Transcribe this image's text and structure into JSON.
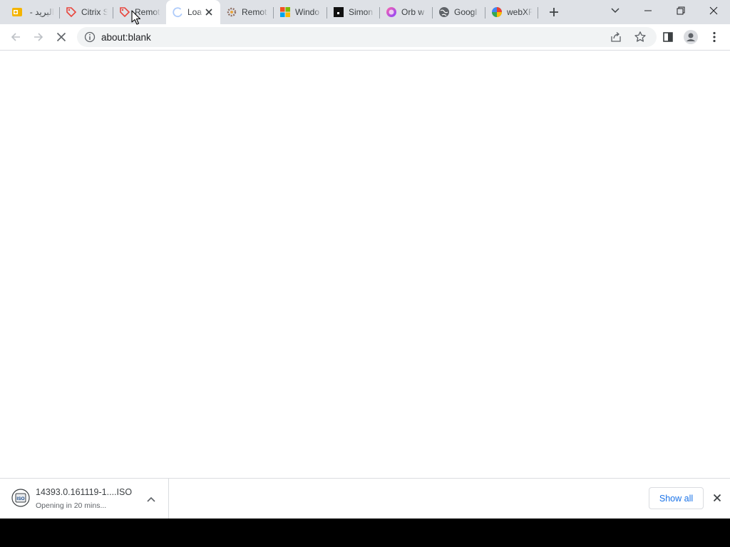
{
  "tabs": [
    {
      "title": "البريد -",
      "icon": "outlook-mail-icon"
    },
    {
      "title": "Citrix S",
      "icon": "tag-icon"
    },
    {
      "title": "Remot",
      "icon": "tag-icon"
    },
    {
      "title": "Loa",
      "icon": "loading-spinner-icon",
      "active": true
    },
    {
      "title": "Remot",
      "icon": "gear-icon"
    },
    {
      "title": "Windo",
      "icon": "windows-logo-icon"
    },
    {
      "title": "Simon",
      "icon": "black-square-icon"
    },
    {
      "title": "Orb w",
      "icon": "orb-icon"
    },
    {
      "title": "Googl",
      "icon": "globe-icon"
    },
    {
      "title": "webXF",
      "icon": "webxp-logo-icon"
    }
  ],
  "omnibox": {
    "url": "about:blank"
  },
  "download": {
    "filename": "14393.0.161119-1....ISO",
    "status": "Opening in 20 mins...",
    "icon_label": "ISO"
  },
  "shelf": {
    "show_all_label": "Show all"
  },
  "colors": {
    "accent": "#1a73e8",
    "tabstrip": "#dee1e6",
    "omnibox": "#f1f3f4"
  }
}
